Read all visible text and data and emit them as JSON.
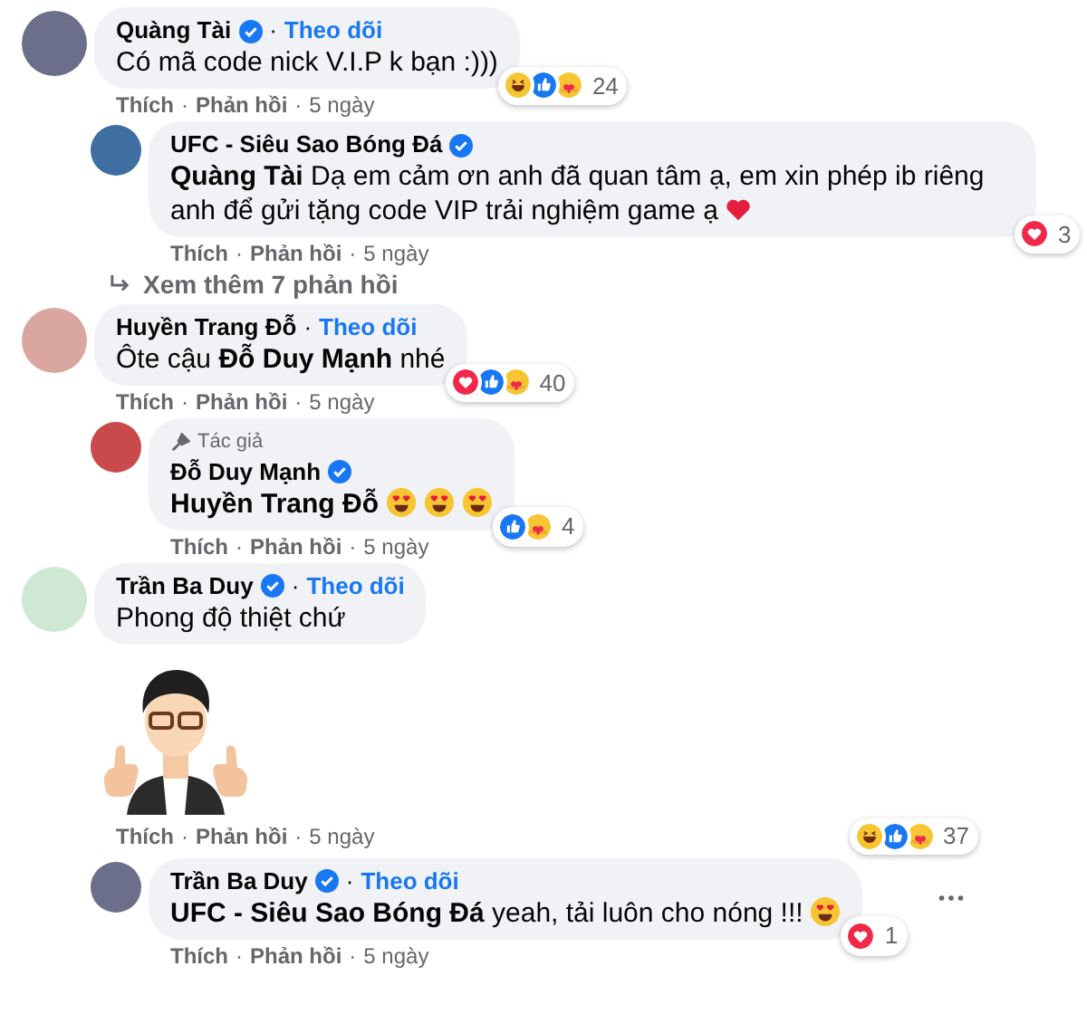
{
  "separator": "·",
  "comments": [
    {
      "kind": "text",
      "name": "Quàng Tài",
      "verified": true,
      "follow": "Theo dõi",
      "body": "Có mã code nick V.I.P k bạn :)))",
      "reactions": {
        "items": [
          {
            "kind": "haha"
          },
          {
            "kind": "like"
          },
          {
            "kind": "care"
          }
        ],
        "count": "24"
      },
      "like_label": "Thích",
      "reply_label": "Phản hồi",
      "time": "5 ngày",
      "menu_visible": false,
      "replies": [
        {
          "kind": "text",
          "name": "UFC - Siêu Sao Bóng Đá",
          "verified": true,
          "body": "**Quàng Tài** Dạ em cảm ơn anh đã quan tâm ạ, em xin phép ib riêng anh để gửi tặng code VIP trải nghiệm game ạ",
          "emoji": [
            {
              "kind": "heart"
            }
          ],
          "reactions": {
            "items": [
              {
                "kind": "love"
              }
            ],
            "count": "3"
          },
          "like_label": "Thích",
          "reply_label": "Phản hồi",
          "time": "5 ngày",
          "menu_visible": false
        }
      ],
      "more_replies": "Xem thêm 7 phản hồi"
    },
    {
      "kind": "text",
      "name": "Huyền Trang Đỗ",
      "verified": false,
      "follow": "Theo dõi",
      "body": "Ôte cậu **Đỗ Duy Mạnh** nhé",
      "reactions": {
        "items": [
          {
            "kind": "love"
          },
          {
            "kind": "like"
          },
          {
            "kind": "care"
          }
        ],
        "count": "40"
      },
      "like_label": "Thích",
      "reply_label": "Phản hồi",
      "time": "5 ngày",
      "menu_visible": false,
      "replies": [
        {
          "kind": "text",
          "badge": "Tác giả",
          "name": "Đỗ Duy Mạnh",
          "verified": true,
          "body": "**Huyền Trang Đỗ**",
          "emoji": [
            {
              "kind": "heart_eyes"
            },
            {
              "kind": "heart_eyes"
            },
            {
              "kind": "heart_eyes"
            }
          ],
          "reactions": {
            "items": [
              {
                "kind": "like"
              },
              {
                "kind": "care"
              }
            ],
            "count": "4"
          },
          "like_label": "Thích",
          "reply_label": "Phản hồi",
          "time": "5 ngày",
          "menu_visible": false
        }
      ]
    },
    {
      "kind": "text",
      "name": "Trần Ba Duy",
      "verified": true,
      "follow": "Theo dõi",
      "body": "Phong độ thiệt chứ",
      "menu_visible": false
    },
    {
      "kind": "sticker",
      "reactions": {
        "items": [
          {
            "kind": "haha"
          },
          {
            "kind": "like"
          },
          {
            "kind": "care"
          }
        ],
        "count": "37"
      },
      "like_label": "Thích",
      "reply_label": "Phản hồi",
      "time": "5 ngày",
      "menu_visible": false,
      "replies": [
        {
          "kind": "text",
          "name": "Trần Ba Duy",
          "verified": true,
          "follow": "Theo dõi",
          "body": "**UFC - Siêu Sao Bóng Đá** yeah, tải luôn cho nóng !!!",
          "emoji": [
            {
              "kind": "heart_eyes"
            }
          ],
          "reactions": {
            "items": [
              {
                "kind": "love"
              }
            ],
            "count": "1"
          },
          "like_label": "Thích",
          "reply_label": "Phản hồi",
          "time": "5 ngày",
          "menu_visible": true
        }
      ]
    }
  ]
}
